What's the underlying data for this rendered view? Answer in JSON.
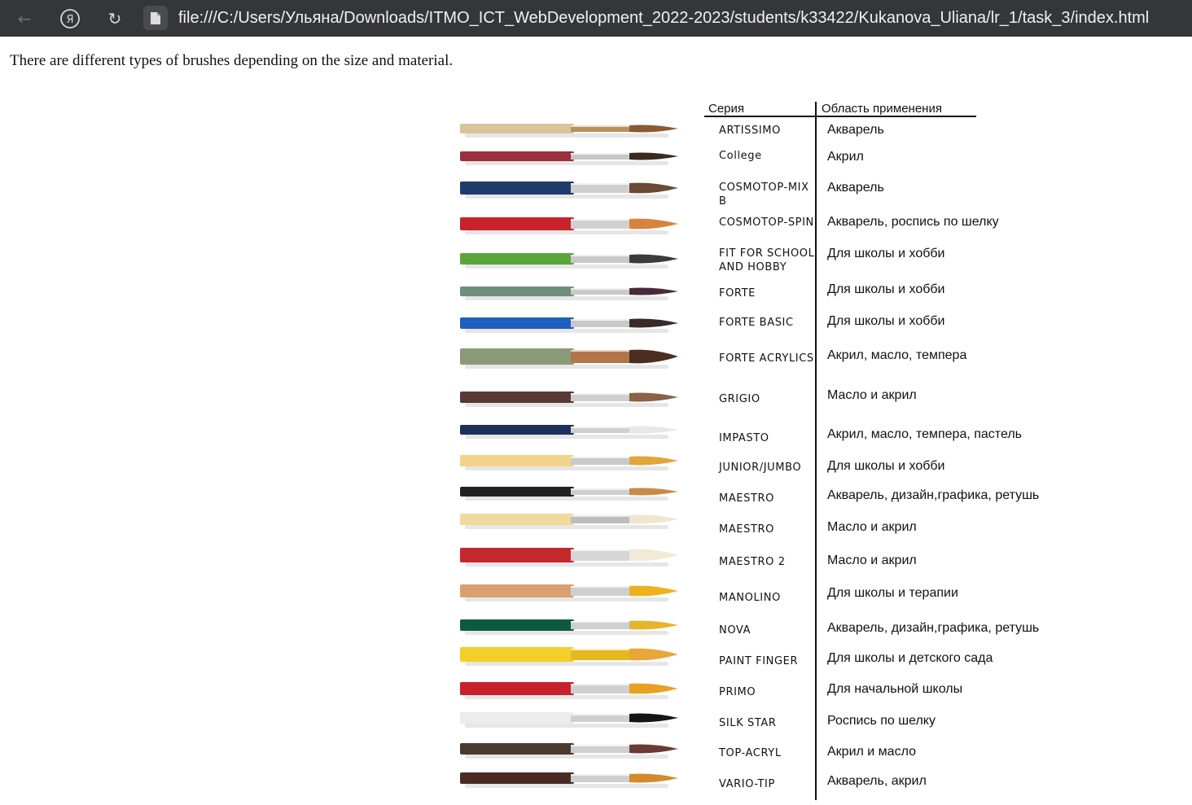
{
  "browser": {
    "url": "file:///C:/Users/Ульяна/Downloads/ITMO_ICT_WebDevelopment_2022-2023/students/k33422/Kukanova_Uliana/lr_1/task_3/index.html",
    "back_icon": "←",
    "yandex_icon": "Я",
    "reload_icon": "↻"
  },
  "page": {
    "intro": "There are different types of brushes depending on the size and material."
  },
  "figure": {
    "header_series": "Серия",
    "header_use": "Область применения",
    "rows": [
      {
        "series": "ARTISSIMO",
        "use": "Акварель",
        "handle": "#d9c39a",
        "ferrule": "#b98f5a",
        "tip": "#8a5a35"
      },
      {
        "series": "College",
        "use": "Акрил",
        "handle": "#9b2f3d",
        "ferrule": "#c7c7c7",
        "tip": "#3a2a20"
      },
      {
        "series": "COSMOTOP-MIX B",
        "use": "Акварель",
        "handle": "#1f3b6b",
        "ferrule": "#cfcfcf",
        "tip": "#6b4a33"
      },
      {
        "series": "COSMOTOP-SPIN",
        "use": "Акварель, роспись по шелку",
        "handle": "#c8232c",
        "ferrule": "#d0d0d0",
        "tip": "#d9823b"
      },
      {
        "series": "FIT FOR SCHOOL\nAND HOBBY",
        "use": "Для школы и хобби",
        "handle": "#5aa63a",
        "ferrule": "#c9c9c9",
        "tip": "#3b3b3b"
      },
      {
        "series": "FORTE",
        "use": "Для школы и хобби",
        "handle": "#6f8f7a",
        "ferrule": "#c9c9c9",
        "tip": "#4a2a3a"
      },
      {
        "series": "FORTE BASIC",
        "use": "Для школы и хобби",
        "handle": "#1f5fc0",
        "ferrule": "#c9c9c9",
        "tip": "#3a2a2a"
      },
      {
        "series": "FORTE ACRYLICS",
        "use": "Акрил, масло, темпера",
        "handle": "#8a9a78",
        "ferrule": "#b0764a",
        "tip": "#4a2e22"
      },
      {
        "series": "GRIGIO",
        "use": "Масло и акрил",
        "handle": "#5a3a36",
        "ferrule": "#cfcfcf",
        "tip": "#8a6246"
      },
      {
        "series": "IMPASTO",
        "use": "Акрил, масло, темпера, пастель",
        "handle": "#1e2f5a",
        "ferrule": "#d0d0d0",
        "tip": "#e8e8e8"
      },
      {
        "series": "JUNIOR/JUMBO",
        "use": "Для школы и хобби",
        "handle": "#f1d48a",
        "ferrule": "#c9c9c9",
        "tip": "#e3a43a"
      },
      {
        "series": "MAESTRO",
        "use": "Акварель, дизайн,графика, ретушь",
        "handle": "#222222",
        "ferrule": "#cfcfcf",
        "tip": "#c88a4a"
      },
      {
        "series": "MAESTRO",
        "use": "Масло и акрил",
        "handle": "#f0d99a",
        "ferrule": "#bdbdbd",
        "tip": "#efe6cf"
      },
      {
        "series": "MAESTRO 2",
        "use": "Масло и акрил",
        "handle": "#c5282c",
        "ferrule": "#d6d6d6",
        "tip": "#f2ead6"
      },
      {
        "series": "MANOLINO",
        "use": "Для школы и терапии",
        "handle": "#d8a070",
        "ferrule": "#cfcfcf",
        "tip": "#efb21e"
      },
      {
        "series": "NOVA",
        "use": "Акварель, дизайн,графика, ретушь",
        "handle": "#0f5a3e",
        "ferrule": "#cfcfcf",
        "tip": "#e4b42c"
      },
      {
        "series": "PAINT FINGER",
        "use": "Для школы и детского сада",
        "handle": "#f2cf2a",
        "ferrule": "#e6b820",
        "tip": "#e9a63a"
      },
      {
        "series": "PRIMO",
        "use": "Для начальной школы",
        "handle": "#c8202c",
        "ferrule": "#d0d0d0",
        "tip": "#e7a124"
      },
      {
        "series": "SILK STAR",
        "use": "Роспись по шелку",
        "handle": "#ececec",
        "ferrule": "#cfcfcf",
        "tip": "#151515"
      },
      {
        "series": "TOP-ACRYL",
        "use": "Акрил и масло",
        "handle": "#4a3a30",
        "ferrule": "#cfcfcf",
        "tip": "#6a3a34"
      },
      {
        "series": "VARIO-TIP",
        "use": "Акварель, акрил",
        "handle": "#4a2b24",
        "ferrule": "#cfcfcf",
        "tip": "#d28a2a"
      }
    ]
  }
}
